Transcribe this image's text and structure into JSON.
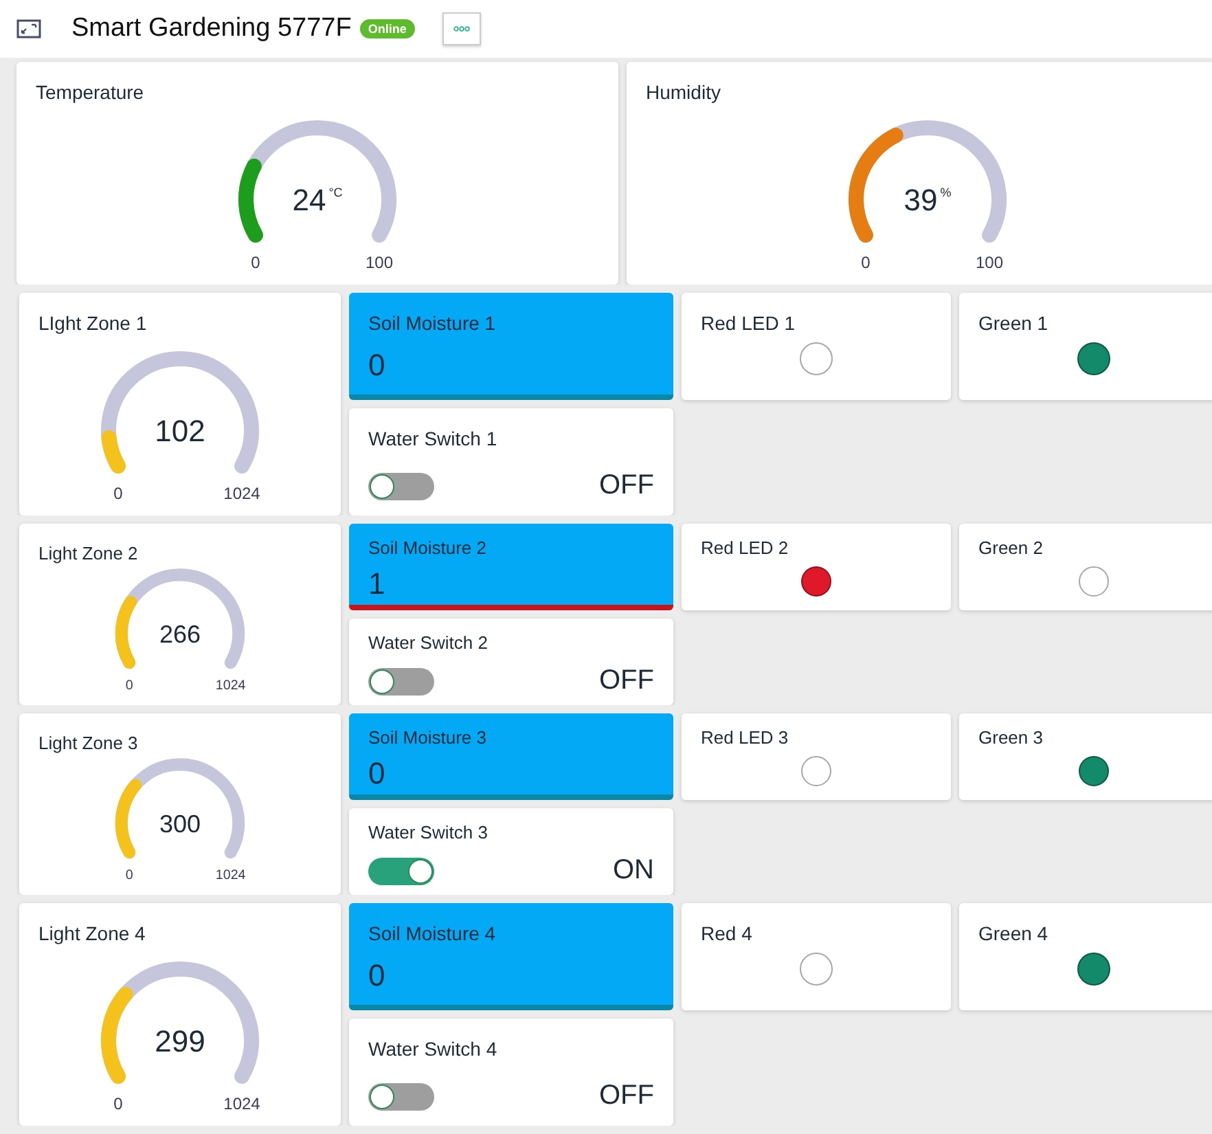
{
  "header": {
    "title": "Smart Gardening 5777F",
    "status": "Online"
  },
  "top_gauges": [
    {
      "title": "Temperature",
      "value": "24",
      "unit": "°C",
      "min": "0",
      "max": "100",
      "color": "#1c9e1c"
    },
    {
      "title": "Humidity",
      "value": "39",
      "unit": "%",
      "min": "0",
      "max": "100",
      "color": "#e57d12"
    }
  ],
  "zones": [
    {
      "light": {
        "title": "LIght Zone 1",
        "value": "102",
        "min": "0",
        "max": "1024",
        "color": "#f5c21b"
      },
      "soil": {
        "title": "Soil Moisture 1",
        "value": "0",
        "alert": false
      },
      "switch": {
        "title": "Water Switch 1",
        "on": false,
        "state": "OFF"
      },
      "leds": [
        {
          "title": "Red LED 1",
          "on": false
        },
        {
          "title": "Green 1",
          "on": true,
          "color": "#138a6a"
        }
      ]
    },
    {
      "light": {
        "title": "Light Zone 2",
        "value": "266",
        "min": "0",
        "max": "1024",
        "color": "#f5c21b"
      },
      "soil": {
        "title": "Soil Moisture 2",
        "value": "1",
        "alert": true
      },
      "switch": {
        "title": "Water Switch 2",
        "on": false,
        "state": "OFF"
      },
      "leds": [
        {
          "title": "Red LED 2",
          "on": true,
          "color": "#e0192a"
        },
        {
          "title": "Green 2",
          "on": false
        }
      ]
    },
    {
      "light": {
        "title": "Light Zone 3",
        "value": "300",
        "min": "0",
        "max": "1024",
        "color": "#f5c21b"
      },
      "soil": {
        "title": "Soil Moisture 3",
        "value": "0",
        "alert": false
      },
      "switch": {
        "title": "Water Switch 3",
        "on": true,
        "state": "ON"
      },
      "leds": [
        {
          "title": "Red LED 3",
          "on": false
        },
        {
          "title": "Green 3",
          "on": true,
          "color": "#138a6a"
        }
      ]
    },
    {
      "light": {
        "title": "Light Zone 4",
        "value": "299",
        "min": "0",
        "max": "1024",
        "color": "#f5c21b"
      },
      "soil": {
        "title": "Soil Moisture 4",
        "value": "0",
        "alert": false
      },
      "switch": {
        "title": "Water Switch 4",
        "on": false,
        "state": "OFF"
      },
      "leds": [
        {
          "title": "Red 4",
          "on": false
        },
        {
          "title": "Green 4",
          "on": true,
          "color": "#138a6a"
        }
      ]
    }
  ]
}
